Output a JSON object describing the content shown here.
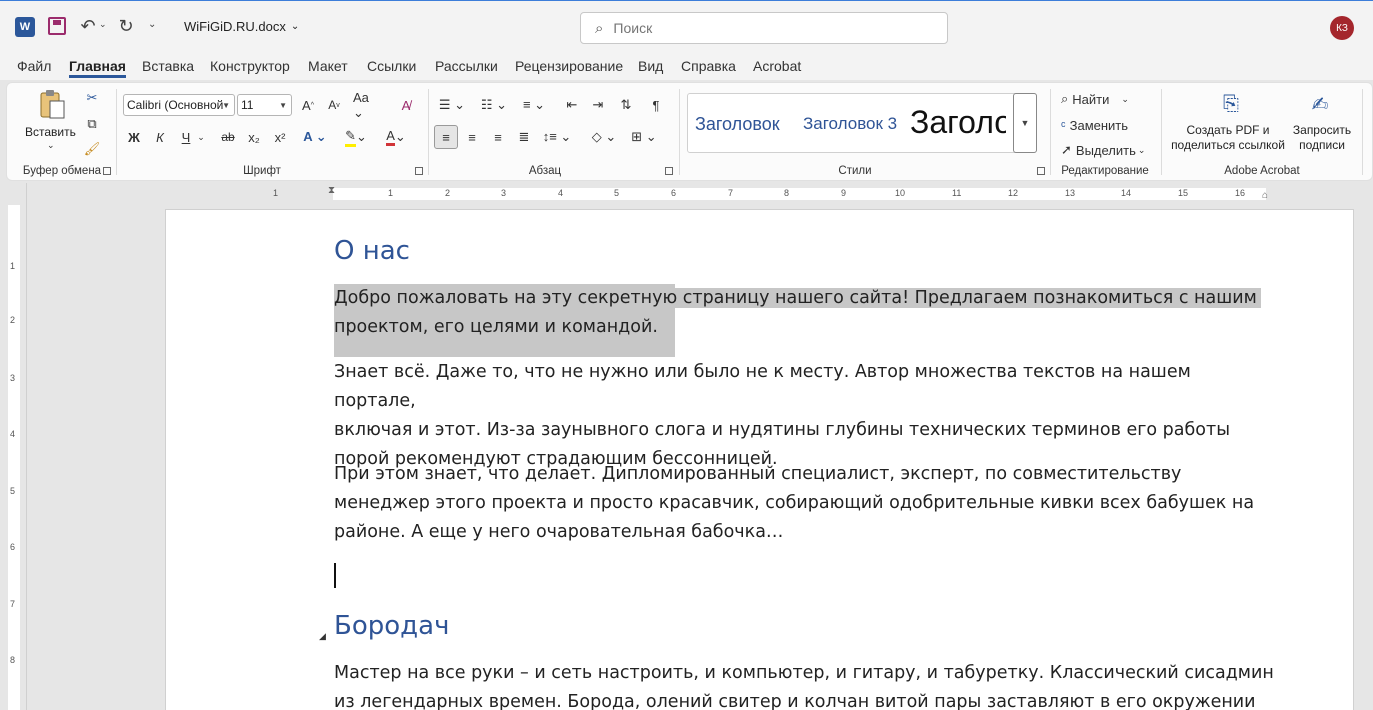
{
  "titlebar": {
    "app_icon": "word-logo-icon",
    "doc_name": "WiFiGiD.RU.docx",
    "search_placeholder": "Поиск",
    "avatar_initials": "КЗ"
  },
  "tabs": [
    "Файл",
    "Главная",
    "Вставка",
    "Конструктор",
    "Макет",
    "Ссылки",
    "Рассылки",
    "Рецензирование",
    "Вид",
    "Справка",
    "Acrobat"
  ],
  "active_tab": "Главная",
  "ribbon": {
    "clipboard": {
      "paste_label": "Вставить",
      "group_label": "Буфер обмена"
    },
    "font": {
      "font_name": "Calibri (Основной",
      "font_size": "11",
      "group_label": "Шрифт",
      "bold": "Ж",
      "italic": "К",
      "underline": "Ч",
      "strike": "ab",
      "sub": "x₂",
      "sup": "x²"
    },
    "paragraph": {
      "group_label": "Абзац"
    },
    "styles": {
      "items": [
        "Заголовок",
        "Заголовок 3",
        "Заголо"
      ],
      "group_label": "Стили"
    },
    "editing": {
      "find": "Найти",
      "replace": "Заменить",
      "select": "Выделить",
      "group_label": "Редактирование"
    },
    "acrobat": {
      "create_pdf": "Создать PDF и поделиться ссылкой",
      "create_pdf_l1": "Создать PDF и",
      "create_pdf_l2": "поделиться ссылкой",
      "request_sign_l1": "Запросить",
      "request_sign_l2": "подписи",
      "group_label": "Adobe Acrobat"
    }
  },
  "ruler": {
    "h_numbers": [
      "1",
      "1",
      "2",
      "3",
      "4",
      "5",
      "6",
      "7",
      "8",
      "9",
      "10",
      "11",
      "12",
      "13",
      "14",
      "15",
      "16"
    ],
    "v_numbers": [
      "1",
      "1",
      "2",
      "3",
      "4",
      "5",
      "6",
      "7",
      "8"
    ]
  },
  "document": {
    "heading1": "О нас",
    "p1_l1": "Добро пожаловать на эту секретную страницу нашего сайта! Предлагаем познакомиться с нашим",
    "p1_l2": "проектом, его целями и командой.",
    "p2_l1": "Знает всё. Даже то, что не нужно или было не к месту. Автор множества текстов на нашем портале,",
    "p2_l2": "включая и этот. Из-за заунывного слога и нудятины глубины технических терминов его работы",
    "p2_l3": "порой рекомендуют страдающим бессонницей.",
    "p3_l1": "При этом знает, что делает. Дипломированный специалист, эксперт, по совместительству",
    "p3_l2": "менеджер этого проекта и просто красавчик, собирающий одобрительные кивки всех бабушек на",
    "p3_l3": "районе. А еще у него очаровательная бабочка…",
    "heading2": "Бородач",
    "p4_l1": "Мастер на все руки – и сеть настроить, и компьютер, и гитару, и табуретку. Классический сисадмин",
    "p4_l2": "из легендарных времен. Борода, олений свитер и колчан витой пары заставляют в его окружении"
  }
}
